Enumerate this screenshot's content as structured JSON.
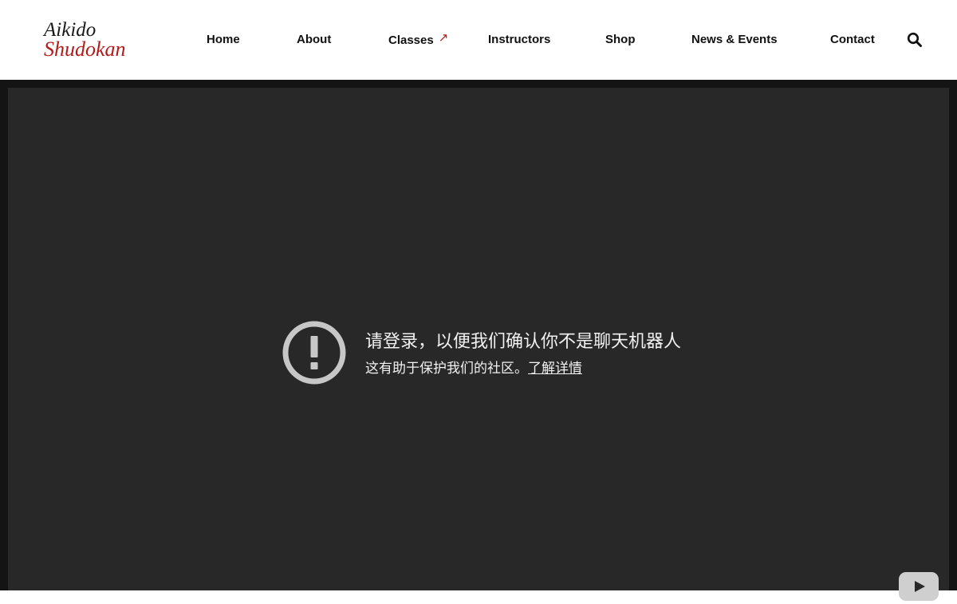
{
  "brand": {
    "line1": "Aikido",
    "line2": "Shudokan",
    "accent_color": "#b31b1b"
  },
  "nav": {
    "items": [
      {
        "label": "Home"
      },
      {
        "label": "About"
      },
      {
        "label": "Classes",
        "icon": "arrow-up-right-icon"
      },
      {
        "label": "Instructors"
      },
      {
        "label": "Shop"
      },
      {
        "label": "News & Events"
      },
      {
        "label": "Contact"
      }
    ],
    "search_icon": "search-icon"
  },
  "player": {
    "background": "#282828",
    "error_icon": "exclamation-circle-icon",
    "error_title": "请登录，以便我们确认你不是聊天机器人",
    "error_subtitle": "这有助于保护我们的社区。",
    "learn_more": "了解详情",
    "brand_icon": "youtube-play-icon"
  }
}
